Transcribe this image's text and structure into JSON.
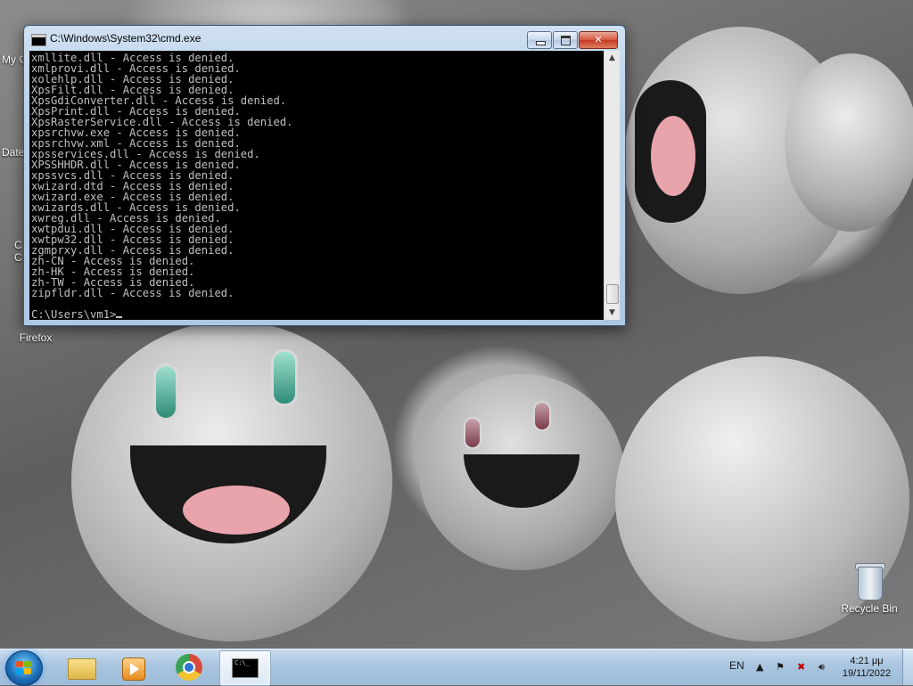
{
  "desktop": {
    "icons": [
      {
        "label": "Firefox"
      },
      {
        "label": "Recycle Bin"
      }
    ],
    "partial_labels": [
      "My C",
      "Date",
      "C",
      "C"
    ]
  },
  "cmd": {
    "title": "C:\\Windows\\System32\\cmd.exe",
    "lines": [
      "xmllite.dll - Access is denied.",
      "xmlprovi.dll - Access is denied.",
      "xolehlp.dll - Access is denied.",
      "XpsFilt.dll - Access is denied.",
      "XpsGdiConverter.dll - Access is denied.",
      "XpsPrint.dll - Access is denied.",
      "XpsRasterService.dll - Access is denied.",
      "xpsrchvw.exe - Access is denied.",
      "xpsrchvw.xml - Access is denied.",
      "xpsservices.dll - Access is denied.",
      "XPSSHHDR.dll - Access is denied.",
      "xpssvcs.dll - Access is denied.",
      "xwizard.dtd - Access is denied.",
      "xwizard.exe - Access is denied.",
      "xwizards.dll - Access is denied.",
      "xwreg.dll - Access is denied.",
      "xwtpdui.dll - Access is denied.",
      "xwtpw32.dll - Access is denied.",
      "zgmprxy.dll - Access is denied.",
      "zh-CN - Access is denied.",
      "zh-HK - Access is denied.",
      "zh-TW - Access is denied.",
      "zipfldr.dll - Access is denied.",
      ""
    ],
    "prompt": "C:\\Users\\vm1>",
    "buttons": {
      "minimize": "minimize",
      "maximize": "maximize",
      "close": "close"
    }
  },
  "taskbar": {
    "apps": [
      {
        "name": "windows-explorer"
      },
      {
        "name": "media-player"
      },
      {
        "name": "google-chrome"
      },
      {
        "name": "command-prompt",
        "glyph": "C:\\_"
      }
    ],
    "language": "EN",
    "time": "4:21 μμ",
    "date": "19/11/2022"
  },
  "colors": {
    "console_bg": "#000000",
    "console_fg": "#c0c0c0",
    "taskbar": "#a9c5df"
  }
}
